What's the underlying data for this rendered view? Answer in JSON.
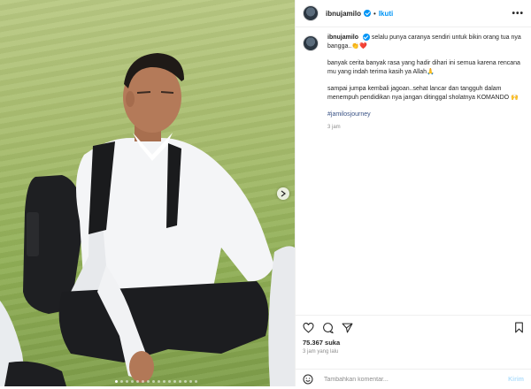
{
  "post": {
    "username": "ibnujamilo",
    "separator": "•",
    "follow_label": "Ikuti",
    "more_label": "•••",
    "caption": {
      "line1": "selalu punya caranya sendiri untuk bikin orang tua nya bangga..👏❤️",
      "para2": "banyak cerita banyak rasa yang hadir dihari ini semua karena rencana mu yang indah terima kasih ya Allah🙏",
      "para3": "sampai jumpa kembali jagoan..sehat lancar dan tangguh dalam menempuh pendidikan nya jangan ditinggal sholatnya KOMANDO 🙌",
      "hashtag": "#jamilosjourney",
      "time": "3 jam"
    },
    "likes": "75.367 suka",
    "posted": "3 jam yang lalu",
    "comment": {
      "placeholder": "Tambahkan komentar...",
      "send_label": "Kirim"
    }
  },
  "colors": {
    "accent": "#0095f6",
    "muted": "#8e8e8e",
    "hashtag": "#385185"
  },
  "icons": [
    "heart-icon",
    "comment-icon",
    "share-icon",
    "bookmark-icon",
    "emoji-icon",
    "chevron-right-icon",
    "verified-icon"
  ]
}
